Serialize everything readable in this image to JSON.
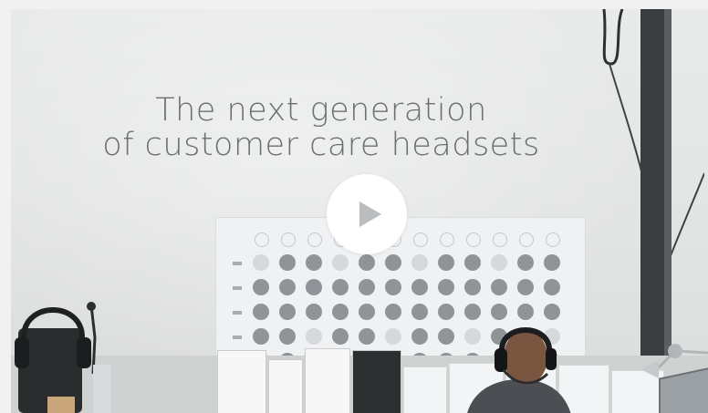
{
  "video": {
    "headline_line1": "The next generation",
    "headline_line2": "of customer care headsets",
    "play_button_icon": "play-icon",
    "play_button_color": "#ffffff",
    "play_icon_color": "#b9bdc0"
  }
}
